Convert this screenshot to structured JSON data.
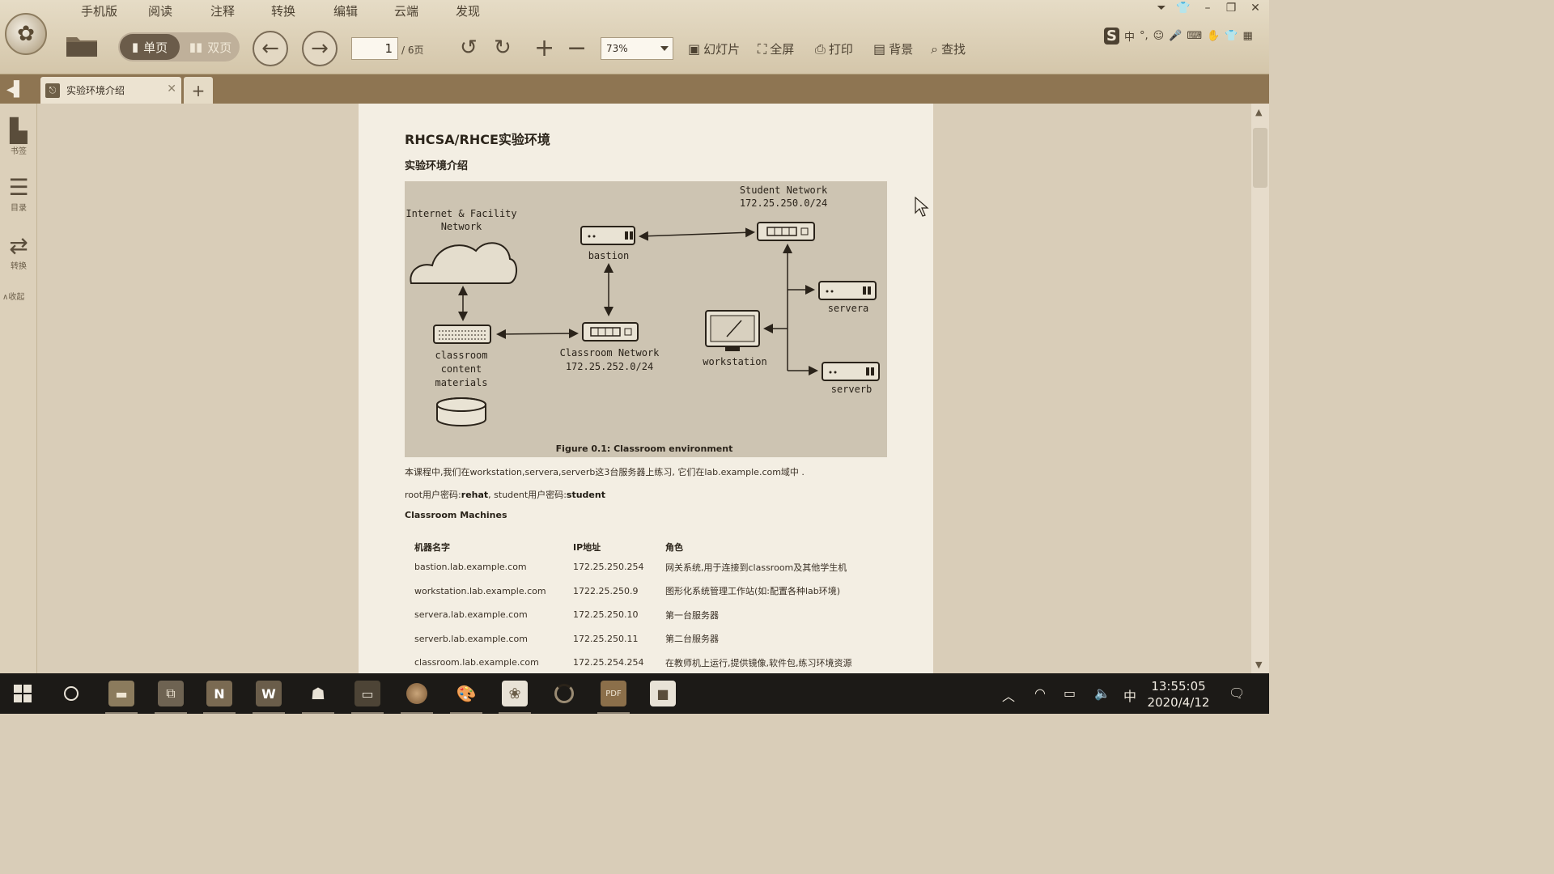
{
  "menubar": {
    "items": [
      {
        "label": "手机版"
      },
      {
        "label": "阅读"
      },
      {
        "label": "注释"
      },
      {
        "label": "转换"
      },
      {
        "label": "编辑"
      },
      {
        "label": "云端"
      },
      {
        "label": "发现"
      }
    ]
  },
  "toolbar": {
    "single_page_label": "单页",
    "double_page_label": "双页",
    "current_page": "1",
    "total_pages": "/ 6页",
    "zoom": "73%",
    "slideshow_label": "幻灯片",
    "fullscreen_label": "全屏",
    "print_label": "打印",
    "background_label": "背景",
    "find_label": "查找"
  },
  "ime": {
    "lang_label": "中"
  },
  "tabs": {
    "active_tab_label": "实验环境介绍",
    "add_label": "+"
  },
  "sidebar": {
    "bookmarks_label": "书签",
    "toc_label": "目录",
    "convert_label": "转换",
    "collapse_label": "∧收起"
  },
  "document": {
    "title": "RHCSA/RHCE实验环境",
    "subtitle": "实验环境介绍",
    "figure": {
      "internet_label_1": "Internet & Facility",
      "internet_label_2": "Network",
      "bastion": "bastion",
      "student_net_1": "Student Network",
      "student_net_2": "172.25.250.0/24",
      "servera": "servera",
      "serverb": "serverb",
      "workstation": "workstation",
      "classroom_net_1": "Classroom Network",
      "classroom_net_2": "172.25.252.0/24",
      "materials_1": "classroom",
      "materials_2": "content",
      "materials_3": "materials",
      "caption": "Figure 0.1: Classroom environment"
    },
    "para1": "本课程中,我们在workstation,servera,serverb这3台服务器上练习, 它们在lab.example.com域中 .",
    "para2_prefix": "root用户密码:",
    "para2_root_pw": "rehat",
    "para2_mid": ", student用户密码:",
    "para2_student_pw": "student",
    "machines_heading": "Classroom Machines",
    "table": {
      "headers": [
        "机器名字",
        "IP地址",
        "角色"
      ],
      "rows": [
        [
          "bastion.lab.example.com",
          "172.25.250.254",
          "网关系统,用于连接到classroom及其他学生机"
        ],
        [
          "workstation.lab.example.com",
          "1722.25.250.9",
          "图形化系统管理工作站(如:配置各种lab环境)"
        ],
        [
          "servera.lab.example.com",
          "172.25.250.10",
          "第一台服务器"
        ],
        [
          "serverb.lab.example.com",
          "172.25.250.11",
          "第二台服务器"
        ],
        [
          "classroom.lab.example.com",
          "172.25.254.254",
          "在教师机上运行,提供镜像,软件包,练习环境资源"
        ]
      ]
    }
  },
  "taskbar": {
    "time": "13:55:05",
    "date": "2020/4/12",
    "ime_label": "中"
  }
}
